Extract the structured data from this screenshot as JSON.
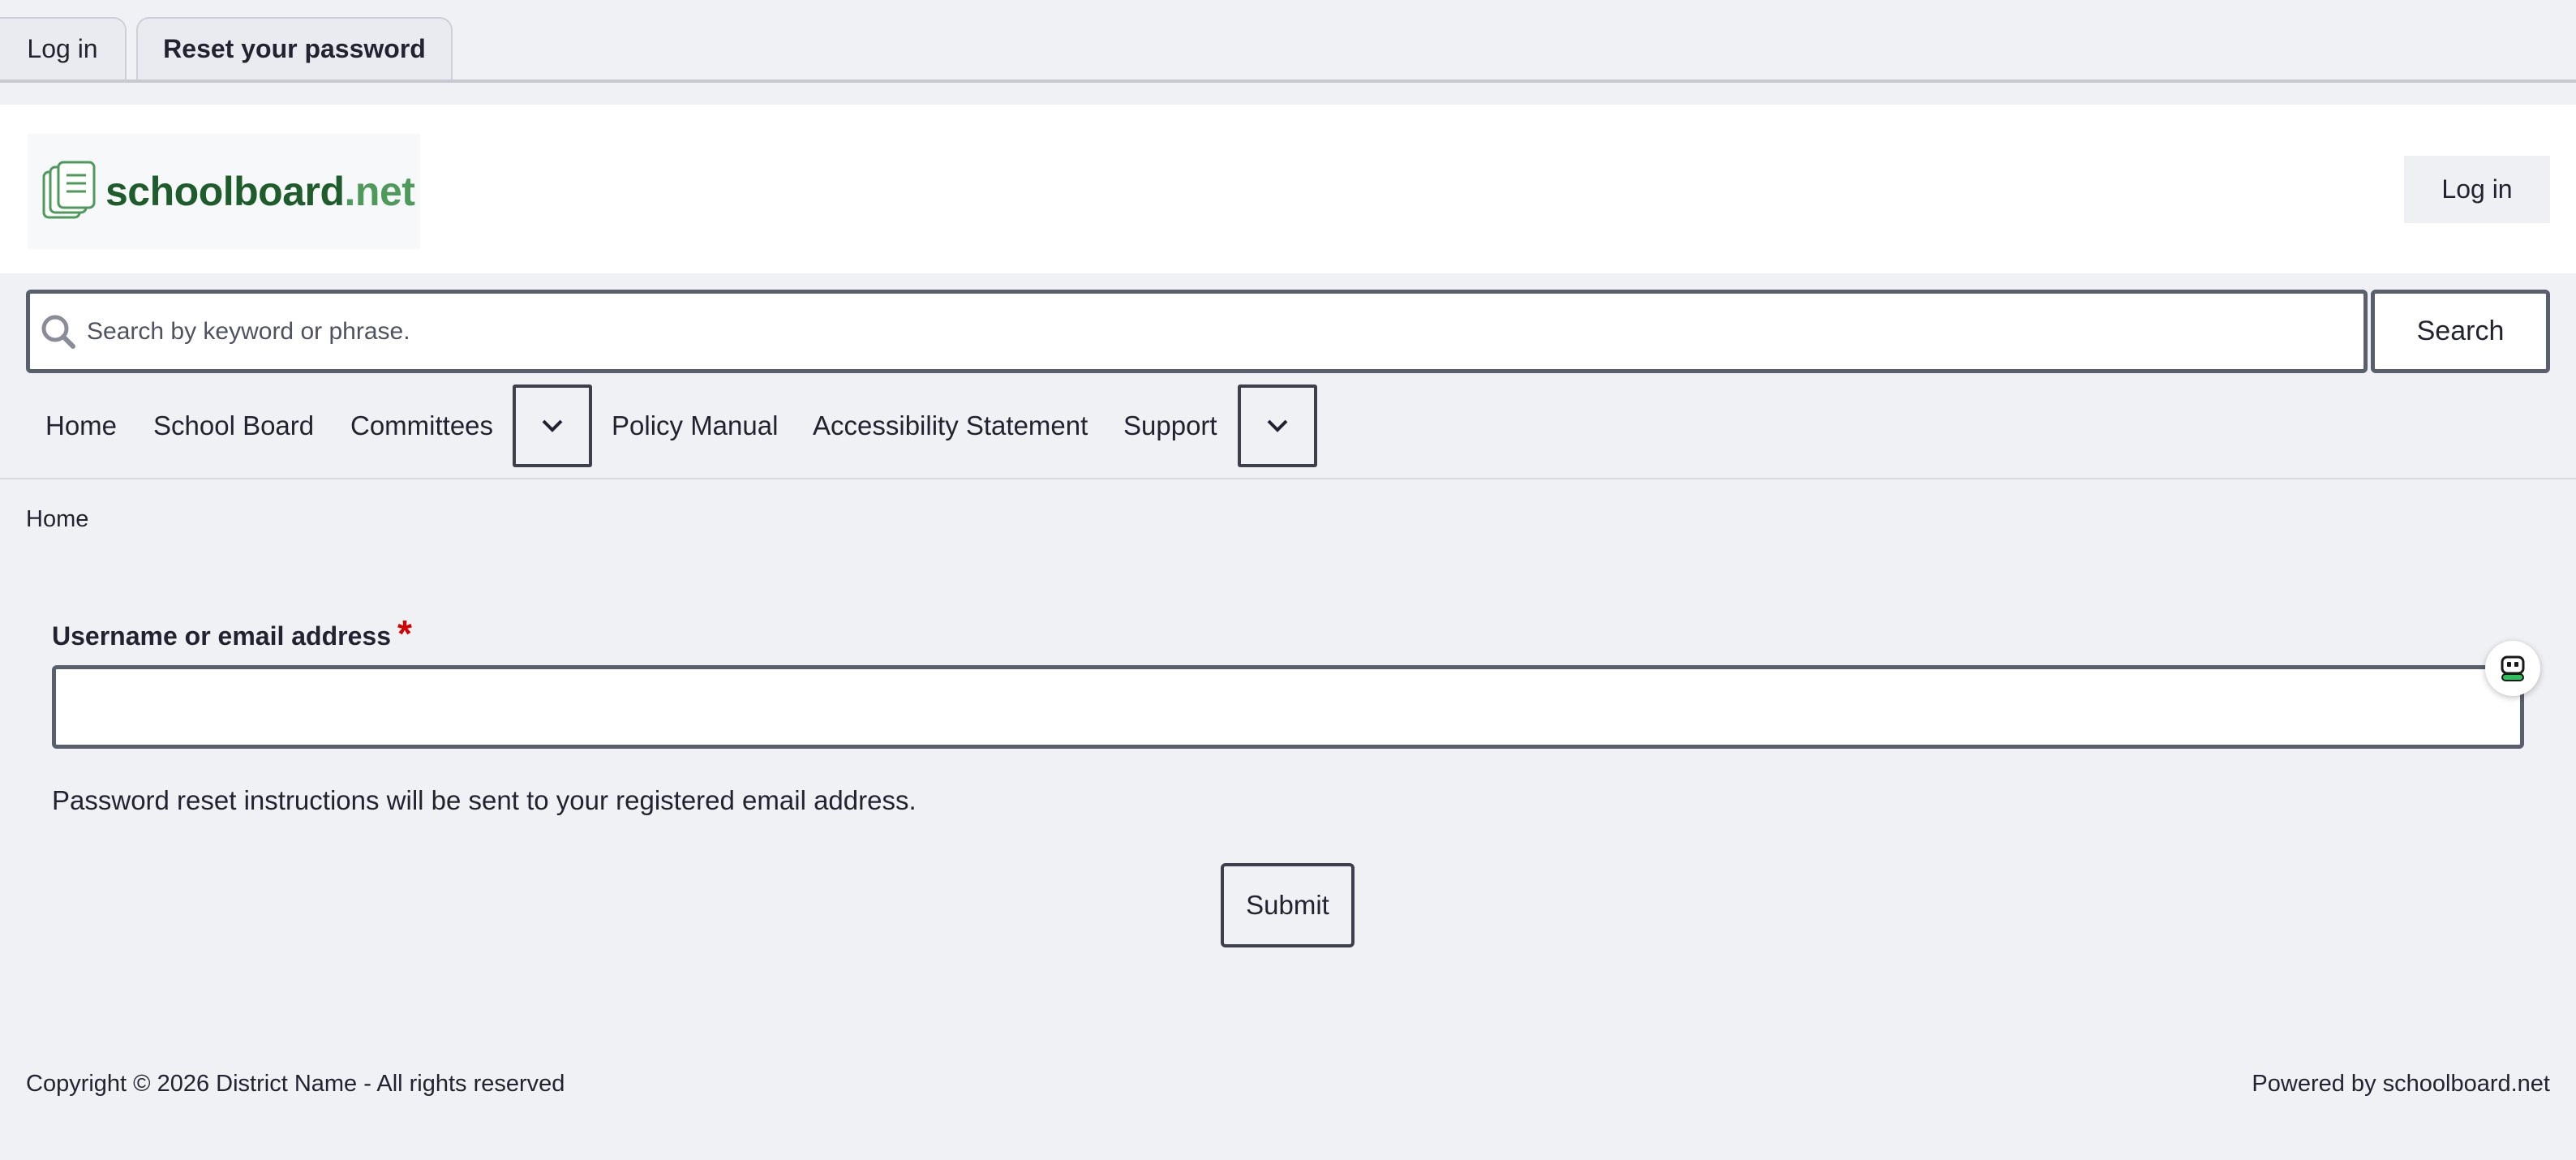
{
  "tabs": [
    {
      "label": "Log in"
    },
    {
      "label": "Reset your password",
      "active": true
    }
  ],
  "header": {
    "logo": {
      "name": "schoolboard",
      "tld": ".net",
      "icon": "documents-icon"
    },
    "login_label": "Log in"
  },
  "search": {
    "placeholder": "Search by keyword or phrase.",
    "value": "",
    "button_label": "Search",
    "icon": "search-icon"
  },
  "nav": {
    "items": [
      {
        "label": "Home"
      },
      {
        "label": "School Board"
      },
      {
        "label": "Committees"
      },
      {
        "label": "Policy Manual"
      },
      {
        "label": "Accessibility Statement"
      },
      {
        "label": "Support"
      }
    ]
  },
  "breadcrumb": {
    "items": [
      "Home"
    ]
  },
  "form": {
    "field_label": "Username or email address",
    "required_marker": "*",
    "field_value": "",
    "helper_text": "Password reset instructions will be sent to your registered email address.",
    "submit_label": "Submit"
  },
  "footer": {
    "copyright": "Copyright © 2026 District Name - All rights reserved",
    "powered_by": "Powered by schoolboard.net"
  },
  "colors": {
    "background": "#f0f1f5",
    "logo_dark_green": "#1f5c2c",
    "logo_light_green": "#4e9a5a",
    "required_red": "#d40000",
    "border": "#5a5f6d"
  }
}
